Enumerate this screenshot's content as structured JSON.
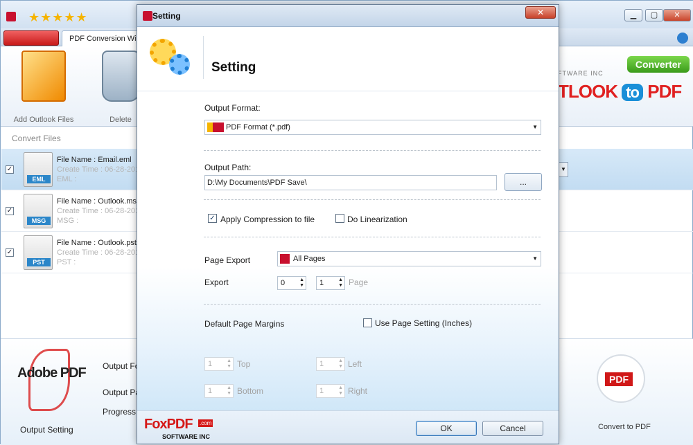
{
  "main": {
    "tab_label": "PDF Conversion Wi",
    "ribbon": {
      "add_files_label": "Add Outlook Files",
      "delete_label": "Delete"
    },
    "brand": {
      "converter_badge": "Converter",
      "title_left": "TLOOK",
      "title_to": "to",
      "title_right": "PDF",
      "sub": "FTWARE INC"
    },
    "convert_files_heading": "Convert Files",
    "files": [
      {
        "checked": true,
        "ext": "EML",
        "name": "File Name : Email.eml",
        "time": "Create Time : 06-28-201",
        "sub": "EML :"
      },
      {
        "checked": true,
        "ext": "MSG",
        "name": "File Name : Outlook.msg",
        "time": "Create Time : 06-28-201",
        "sub": "MSG :"
      },
      {
        "checked": true,
        "ext": "PST",
        "name": "File Name : Outlook.pst",
        "time": "Create Time : 06-28-201",
        "sub": "PST :"
      }
    ],
    "bottom": {
      "adobe_logo": "Adobe PDF",
      "output_setting": "Output Setting",
      "output_format_label": "Output Fo",
      "output_path_label": "Output Pa",
      "progress_label": "Progress",
      "convert_pdf_badge": "PDF",
      "convert_to_pdf": "Convert to PDF"
    }
  },
  "dialog": {
    "title": "Setting",
    "heading": "Setting",
    "close_label": "✕",
    "output_format": {
      "label": "Output Format:",
      "value": "PDF Format (*.pdf)"
    },
    "output_path": {
      "label": "Output Path:",
      "value": "D:\\My Documents\\PDF Save\\",
      "browse_label": "..."
    },
    "apply_compression": {
      "label": "Apply Compression to file",
      "checked": true
    },
    "do_linearization": {
      "label": "Do Linearization",
      "checked": false
    },
    "page_export": {
      "label": "Page Export",
      "value": "All Pages"
    },
    "export": {
      "label": "Export",
      "from": "0",
      "to": "1",
      "page_label": "Page"
    },
    "default_margins": {
      "label": "Default Page Margins"
    },
    "use_page_setting": {
      "label": "Use Page Setting (Inches)",
      "checked": false
    },
    "margins": {
      "top": {
        "label": "Top",
        "value": "1"
      },
      "left": {
        "label": "Left",
        "value": "1"
      },
      "bottom": {
        "label": "Bottom",
        "value": "1"
      },
      "right": {
        "label": "Right",
        "value": "1"
      }
    },
    "footer": {
      "logo_main": "FoxPDF",
      "logo_com": ".com",
      "logo_sub": "SOFTWARE INC",
      "ok_label": "OK",
      "cancel_label": "Cancel"
    }
  },
  "colors": {
    "accent_blue": "#2b86c9",
    "brand_red": "#d51919",
    "selection": "#c2dcf2"
  }
}
